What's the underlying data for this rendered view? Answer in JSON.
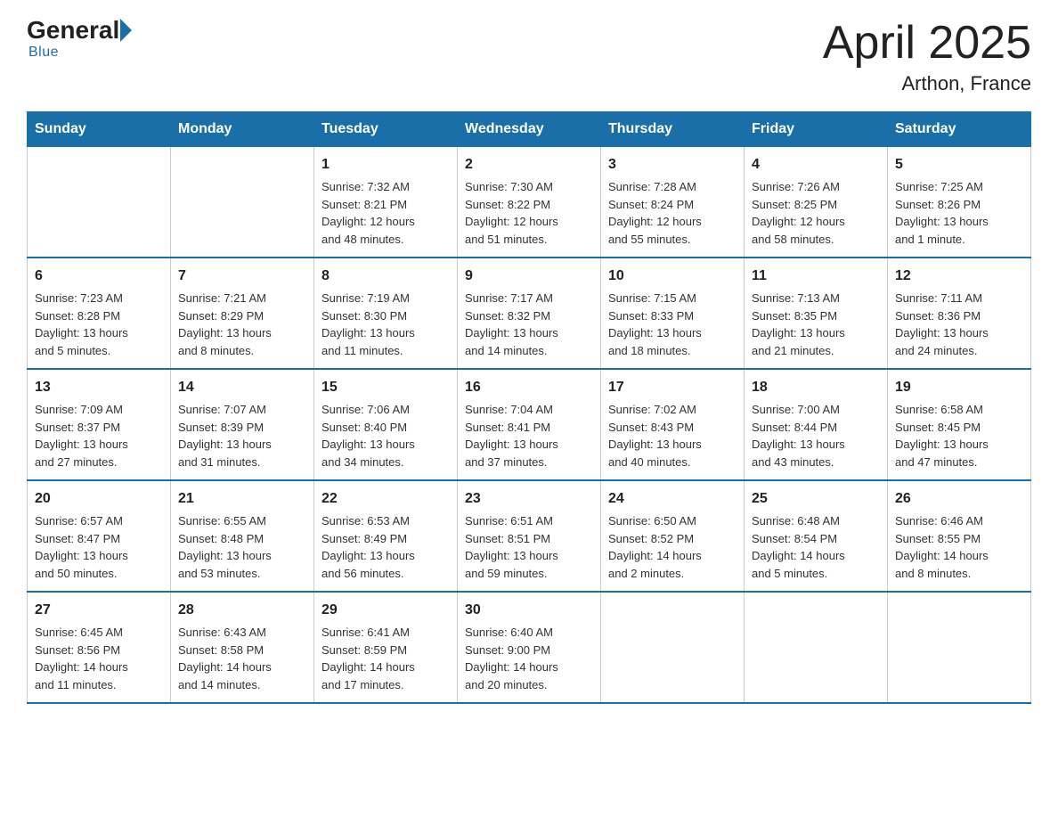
{
  "header": {
    "logo_general": "General",
    "logo_blue": "Blue",
    "title": "April 2025",
    "subtitle": "Arthon, France"
  },
  "weekdays": [
    "Sunday",
    "Monday",
    "Tuesday",
    "Wednesday",
    "Thursday",
    "Friday",
    "Saturday"
  ],
  "weeks": [
    [
      {
        "day": "",
        "info": ""
      },
      {
        "day": "",
        "info": ""
      },
      {
        "day": "1",
        "info": "Sunrise: 7:32 AM\nSunset: 8:21 PM\nDaylight: 12 hours\nand 48 minutes."
      },
      {
        "day": "2",
        "info": "Sunrise: 7:30 AM\nSunset: 8:22 PM\nDaylight: 12 hours\nand 51 minutes."
      },
      {
        "day": "3",
        "info": "Sunrise: 7:28 AM\nSunset: 8:24 PM\nDaylight: 12 hours\nand 55 minutes."
      },
      {
        "day": "4",
        "info": "Sunrise: 7:26 AM\nSunset: 8:25 PM\nDaylight: 12 hours\nand 58 minutes."
      },
      {
        "day": "5",
        "info": "Sunrise: 7:25 AM\nSunset: 8:26 PM\nDaylight: 13 hours\nand 1 minute."
      }
    ],
    [
      {
        "day": "6",
        "info": "Sunrise: 7:23 AM\nSunset: 8:28 PM\nDaylight: 13 hours\nand 5 minutes."
      },
      {
        "day": "7",
        "info": "Sunrise: 7:21 AM\nSunset: 8:29 PM\nDaylight: 13 hours\nand 8 minutes."
      },
      {
        "day": "8",
        "info": "Sunrise: 7:19 AM\nSunset: 8:30 PM\nDaylight: 13 hours\nand 11 minutes."
      },
      {
        "day": "9",
        "info": "Sunrise: 7:17 AM\nSunset: 8:32 PM\nDaylight: 13 hours\nand 14 minutes."
      },
      {
        "day": "10",
        "info": "Sunrise: 7:15 AM\nSunset: 8:33 PM\nDaylight: 13 hours\nand 18 minutes."
      },
      {
        "day": "11",
        "info": "Sunrise: 7:13 AM\nSunset: 8:35 PM\nDaylight: 13 hours\nand 21 minutes."
      },
      {
        "day": "12",
        "info": "Sunrise: 7:11 AM\nSunset: 8:36 PM\nDaylight: 13 hours\nand 24 minutes."
      }
    ],
    [
      {
        "day": "13",
        "info": "Sunrise: 7:09 AM\nSunset: 8:37 PM\nDaylight: 13 hours\nand 27 minutes."
      },
      {
        "day": "14",
        "info": "Sunrise: 7:07 AM\nSunset: 8:39 PM\nDaylight: 13 hours\nand 31 minutes."
      },
      {
        "day": "15",
        "info": "Sunrise: 7:06 AM\nSunset: 8:40 PM\nDaylight: 13 hours\nand 34 minutes."
      },
      {
        "day": "16",
        "info": "Sunrise: 7:04 AM\nSunset: 8:41 PM\nDaylight: 13 hours\nand 37 minutes."
      },
      {
        "day": "17",
        "info": "Sunrise: 7:02 AM\nSunset: 8:43 PM\nDaylight: 13 hours\nand 40 minutes."
      },
      {
        "day": "18",
        "info": "Sunrise: 7:00 AM\nSunset: 8:44 PM\nDaylight: 13 hours\nand 43 minutes."
      },
      {
        "day": "19",
        "info": "Sunrise: 6:58 AM\nSunset: 8:45 PM\nDaylight: 13 hours\nand 47 minutes."
      }
    ],
    [
      {
        "day": "20",
        "info": "Sunrise: 6:57 AM\nSunset: 8:47 PM\nDaylight: 13 hours\nand 50 minutes."
      },
      {
        "day": "21",
        "info": "Sunrise: 6:55 AM\nSunset: 8:48 PM\nDaylight: 13 hours\nand 53 minutes."
      },
      {
        "day": "22",
        "info": "Sunrise: 6:53 AM\nSunset: 8:49 PM\nDaylight: 13 hours\nand 56 minutes."
      },
      {
        "day": "23",
        "info": "Sunrise: 6:51 AM\nSunset: 8:51 PM\nDaylight: 13 hours\nand 59 minutes."
      },
      {
        "day": "24",
        "info": "Sunrise: 6:50 AM\nSunset: 8:52 PM\nDaylight: 14 hours\nand 2 minutes."
      },
      {
        "day": "25",
        "info": "Sunrise: 6:48 AM\nSunset: 8:54 PM\nDaylight: 14 hours\nand 5 minutes."
      },
      {
        "day": "26",
        "info": "Sunrise: 6:46 AM\nSunset: 8:55 PM\nDaylight: 14 hours\nand 8 minutes."
      }
    ],
    [
      {
        "day": "27",
        "info": "Sunrise: 6:45 AM\nSunset: 8:56 PM\nDaylight: 14 hours\nand 11 minutes."
      },
      {
        "day": "28",
        "info": "Sunrise: 6:43 AM\nSunset: 8:58 PM\nDaylight: 14 hours\nand 14 minutes."
      },
      {
        "day": "29",
        "info": "Sunrise: 6:41 AM\nSunset: 8:59 PM\nDaylight: 14 hours\nand 17 minutes."
      },
      {
        "day": "30",
        "info": "Sunrise: 6:40 AM\nSunset: 9:00 PM\nDaylight: 14 hours\nand 20 minutes."
      },
      {
        "day": "",
        "info": ""
      },
      {
        "day": "",
        "info": ""
      },
      {
        "day": "",
        "info": ""
      }
    ]
  ]
}
